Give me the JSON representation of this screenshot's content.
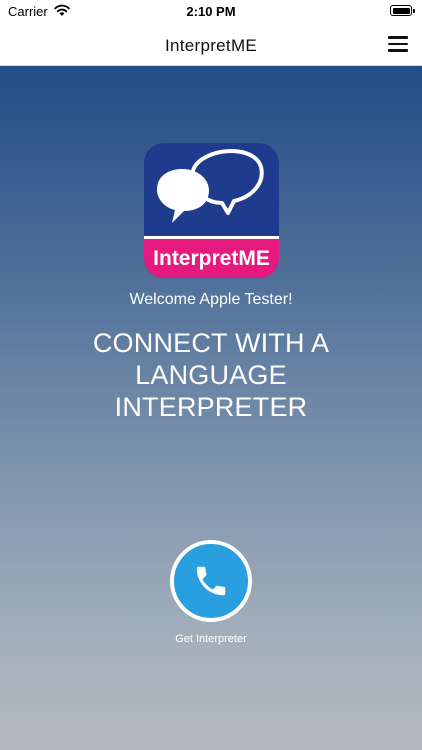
{
  "status_bar": {
    "carrier": "Carrier",
    "time": "2:10 PM",
    "wifi_icon": "wifi-icon",
    "battery_icon": "battery-icon"
  },
  "nav": {
    "title": "InterpretME",
    "menu_icon": "hamburger-menu-icon"
  },
  "logo": {
    "text": "InterpretME",
    "colors": {
      "background": "#1f3b8e",
      "banner": "#e6197e"
    }
  },
  "welcome": "Welcome Apple Tester!",
  "headline": "CONNECT WITH A LANGUAGE INTERPRETER",
  "call": {
    "label": "Get Interpreter",
    "icon": "phone-icon",
    "color": "#2a9fe0"
  }
}
